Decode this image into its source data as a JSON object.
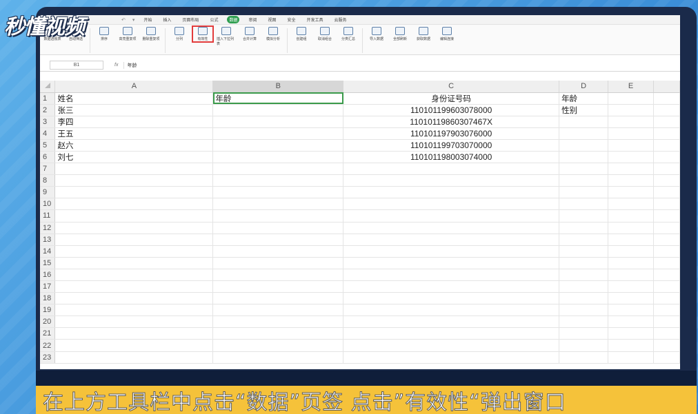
{
  "logo": "秒懂视频",
  "tabs": [
    "开始",
    "插入",
    "页面布局",
    "公式",
    "数据",
    "审阅",
    "视图",
    "安全",
    "开发工具",
    "云服务"
  ],
  "active_tab_index": 4,
  "ribbon": {
    "buttons": [
      "数据透视表",
      "自动筛选",
      "排序",
      "高亮重复项",
      "删除重复项",
      "分列",
      "有效性",
      "插入下拉列表",
      "合并计算",
      "模拟分析",
      "创建组",
      "取消组合",
      "分类汇总",
      "导入数据",
      "全部刷新",
      "获取数据",
      "编辑连接"
    ],
    "highlighted": "有效性"
  },
  "formula_bar": {
    "name_box": "B1",
    "fx": "fx",
    "content": "年龄"
  },
  "columns": [
    "A",
    "B",
    "C",
    "D",
    "E"
  ],
  "rows": [
    [
      "1",
      "姓名",
      "年龄",
      "身份证号码",
      "年龄",
      ""
    ],
    [
      "2",
      "张三",
      "",
      "110101199603078000",
      "性别",
      ""
    ],
    [
      "3",
      "李四",
      "",
      "11010119860307467X",
      "",
      ""
    ],
    [
      "4",
      "王五",
      "",
      "110101197903076000",
      "",
      ""
    ],
    [
      "5",
      "赵六",
      "",
      "110101199703070000",
      "",
      ""
    ],
    [
      "6",
      "刘七",
      "",
      "110101198003074000",
      "",
      ""
    ],
    [
      "7",
      "",
      "",
      "",
      "",
      ""
    ],
    [
      "8",
      "",
      "",
      "",
      "",
      ""
    ],
    [
      "9",
      "",
      "",
      "",
      "",
      ""
    ],
    [
      "10",
      "",
      "",
      "",
      "",
      ""
    ],
    [
      "11",
      "",
      "",
      "",
      "",
      ""
    ],
    [
      "12",
      "",
      "",
      "",
      "",
      ""
    ],
    [
      "13",
      "",
      "",
      "",
      "",
      ""
    ],
    [
      "14",
      "",
      "",
      "",
      "",
      ""
    ],
    [
      "15",
      "",
      "",
      "",
      "",
      ""
    ],
    [
      "16",
      "",
      "",
      "",
      "",
      ""
    ],
    [
      "17",
      "",
      "",
      "",
      "",
      ""
    ],
    [
      "18",
      "",
      "",
      "",
      "",
      ""
    ],
    [
      "19",
      "",
      "",
      "",
      "",
      ""
    ],
    [
      "20",
      "",
      "",
      "",
      "",
      ""
    ],
    [
      "21",
      "",
      "",
      "",
      "",
      ""
    ],
    [
      "22",
      "",
      "",
      "",
      "",
      ""
    ],
    [
      "23",
      "",
      "",
      "",
      "",
      ""
    ]
  ],
  "caption": "在上方工具栏中点击“数据”页签 点击”有效性“弹出窗口",
  "colors": {
    "active_tab": "#2e9e4f",
    "selection": "#3a9a4a",
    "highlight_box": "#e23b3b",
    "caption_bg": "#f5c23a"
  }
}
